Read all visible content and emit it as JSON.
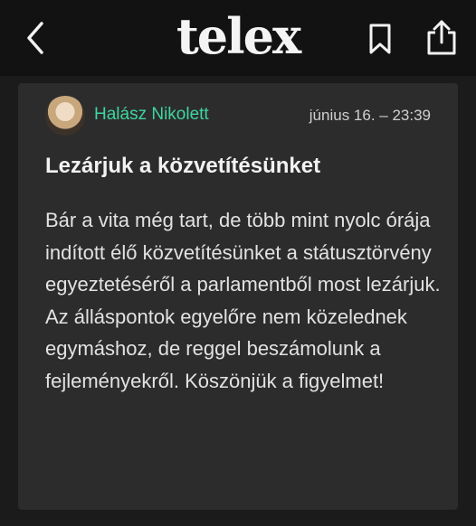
{
  "header": {
    "logo_text": "telex",
    "back_icon": "chevron-left-icon",
    "bookmark_icon": "bookmark-icon",
    "share_icon": "share-icon"
  },
  "post": {
    "author": "Halász Nikolett",
    "timestamp": "június 16. – 23:39",
    "title": "Lezárjuk a közvetítésünket",
    "body": "Bár a vita még tart, de több mint nyolc órája indított élő közvetítésünket a státusztörvény egyeztetéséről a parlamentből most lezárjuk. Az álláspontok egyelőre nem közelednek egymáshoz, de reggel beszámolunk a fejleményekről. Köszönjük a figyelmet!"
  },
  "colors": {
    "accent": "#3ed5a0",
    "background": "#1b1b1b",
    "card": "#2c2c2c",
    "header": "#121212"
  }
}
